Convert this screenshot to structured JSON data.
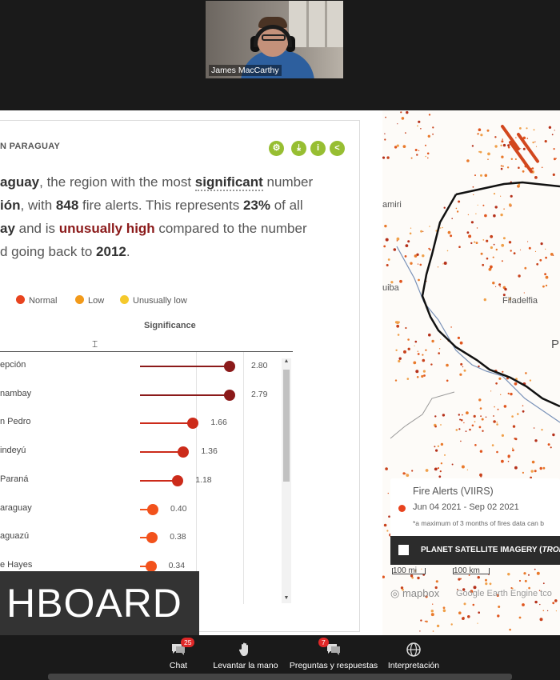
{
  "meeting": {
    "participant_name": "James MacCarthy"
  },
  "dashboard": {
    "panel_title": "N PARAGUAY",
    "tools": [
      "gear-icon",
      "download-icon",
      "info-icon",
      "share-icon"
    ],
    "sentence": {
      "l1a": "aguay",
      "l1b": ", the region with the most ",
      "l1c": "significant",
      "l1d": " number",
      "l2a": "ión",
      "l2b": ", with ",
      "l2c": "848",
      "l2d": " fire alerts. This represents ",
      "l2e": "23%",
      "l2f": " of all",
      "l3a": "ay",
      "l3b": " and is ",
      "l3c": "unusually high",
      "l3d": " compared to the number",
      "l4a": "d going back to ",
      "l4b": "2012",
      "l4c": "."
    },
    "legend": [
      {
        "label": "Normal",
        "color": "#e8431e"
      },
      {
        "label": "Low",
        "color": "#f29a1a"
      },
      {
        "label": "Unusually low",
        "color": "#f5c92c"
      }
    ],
    "significance_header": "Significance",
    "rows": [
      {
        "name": "epción",
        "value": "2.80",
        "color": "#8b1a1a"
      },
      {
        "name": "nambay",
        "value": "2.79",
        "color": "#8b1a1a"
      },
      {
        "name": "n Pedro",
        "value": "1.66",
        "color": "#cc2b1a"
      },
      {
        "name": "indeyú",
        "value": "1.36",
        "color": "#cc2b1a"
      },
      {
        "name": "Paraná",
        "value": "1.18",
        "color": "#cc2b1a"
      },
      {
        "name": "araguay",
        "value": "0.40",
        "color": "#f2521c"
      },
      {
        "name": "aguazú",
        "value": "0.38",
        "color": "#f2521c"
      },
      {
        "name": "e Hayes",
        "value": "0.34",
        "color": "#f2521c"
      }
    ],
    "banner_text": "HBOARD"
  },
  "map": {
    "labels": {
      "amiri": "amiri",
      "filadelfia": "Filadelfia",
      "uiba": "uiba",
      "p": "P"
    },
    "fire_card": {
      "title": "Fire Alerts (VIIRS)",
      "date_range": "Jun 04 2021 - Sep 02 2021",
      "note": "*a maximum of 3 months of fires data can b"
    },
    "planet_label_a": "PLANET SATELLITE IMAGERY (",
    "planet_label_b": "TROPICS",
    "planet_label_c": ")",
    "scale_1": "100 mi",
    "scale_2": "100 km",
    "mapbox": "mapbox",
    "attribution": "Google Earth Engine  tco"
  },
  "toolbar": {
    "items": [
      {
        "label": "Chat",
        "badge": "25"
      },
      {
        "label": "Levantar la mano"
      },
      {
        "label": "Preguntas y respuestas",
        "badge": "7"
      },
      {
        "label": "Interpretación"
      }
    ]
  }
}
